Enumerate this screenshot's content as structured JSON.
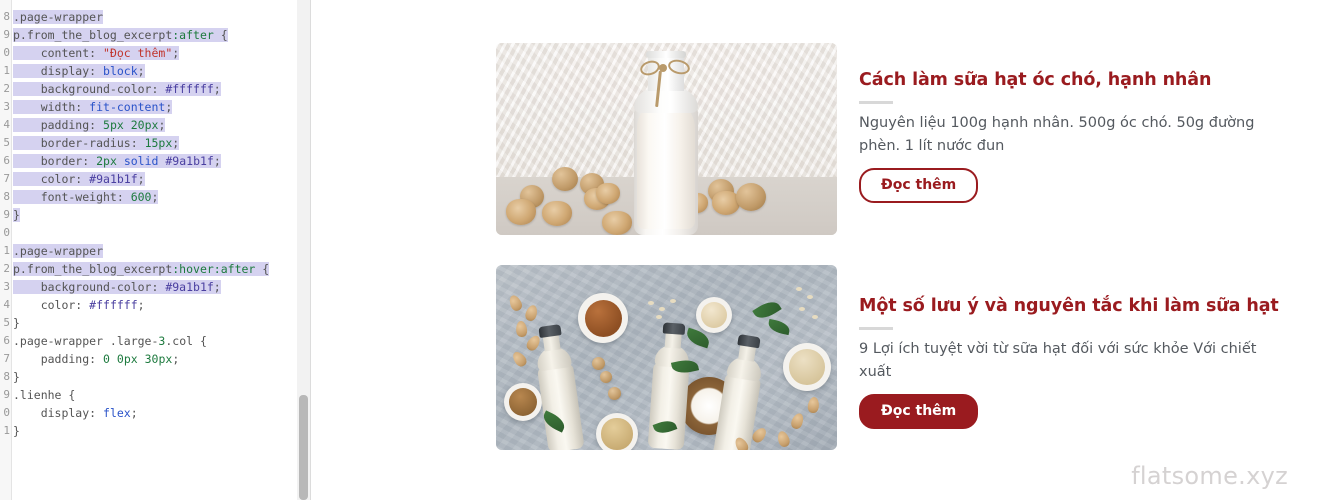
{
  "editor": {
    "gutter_line_numbers": [
      "8",
      "9",
      "0",
      "1",
      "2",
      "3",
      "4",
      "5",
      "6",
      "7",
      "8",
      "9",
      "0",
      "1",
      "2",
      "3",
      "4",
      "5",
      "6",
      "7",
      "8",
      "9"
    ],
    "lines": [
      {
        "n": "8",
        "text": ".page-wrapper"
      },
      {
        "n": "9",
        "text": "p.from_the_blog_excerpt:after {"
      },
      {
        "n": "0",
        "text": "    content: \"Đọc thêm\";"
      },
      {
        "n": "1",
        "text": "    display: block;"
      },
      {
        "n": "2",
        "text": "    background-color: #ffffff;"
      },
      {
        "n": "3",
        "text": "    width: fit-content;"
      },
      {
        "n": "4",
        "text": "    padding: 5px 20px;"
      },
      {
        "n": "5",
        "text": "    border-radius: 15px;"
      },
      {
        "n": "6",
        "text": "    border: 2px solid #9a1b1f;"
      },
      {
        "n": "7",
        "text": "    color: #9a1b1f;"
      },
      {
        "n": "8",
        "text": "    font-weight: 600;"
      },
      {
        "n": "9",
        "text": "}"
      },
      {
        "n": "0",
        "text": ""
      },
      {
        "n": "1",
        "text": ".page-wrapper"
      },
      {
        "n": "2",
        "text": "p.from_the_blog_excerpt:hover:after {"
      },
      {
        "n": "3",
        "text": "    background-color: #9a1b1f;"
      },
      {
        "n": "4",
        "text": "    color: #ffffff;"
      },
      {
        "n": "5",
        "text": "}"
      },
      {
        "n": "6",
        "text": ".page-wrapper .large-3.col {"
      },
      {
        "n": "7",
        "text": "    padding: 0 0px 30px;"
      },
      {
        "n": "8",
        "text": "}"
      },
      {
        "n": "9",
        "text": ".lienhe {"
      },
      {
        "n": "0",
        "text": "    display: flex;"
      },
      {
        "n": "1",
        "text": "}"
      }
    ],
    "colors": {
      "selection": "#d5d2f0",
      "selector": "#545454",
      "pseudo_class": "#1d7a3e",
      "string": "#c1342c",
      "keyword": "#2a53c9",
      "number": "#1d7a3e",
      "hex_value": "#4a3fa0"
    }
  },
  "posts": [
    {
      "title": "Cách làm sữa hạt óc chó, hạnh nhân",
      "excerpt": "Nguyên liệu 100g hạnh nhân. 500g óc chó. 50g đường phèn. 1 lít nước đun",
      "button_label": "Đọc thêm",
      "button_state": "normal",
      "image_alt": "Bình sữa hạt óc chó với quả óc chó"
    },
    {
      "title": "Một số lưu ý và nguyên tắc khi làm sữa hạt",
      "excerpt": "9 Lợi ích tuyệt vời từ sữa hạt đối với sức khỏe Với chiết xuất",
      "button_label": "Đọc thêm",
      "button_state": "hover",
      "image_alt": "Ba chai sữa hạt với hạnh nhân, dừa, yến mạch"
    }
  ],
  "watermark": "flatsome.xyz",
  "theme": {
    "brand_red": "#9a1b1f",
    "text_gray": "#54595f",
    "watermark_gray": "#d5d2d2"
  }
}
